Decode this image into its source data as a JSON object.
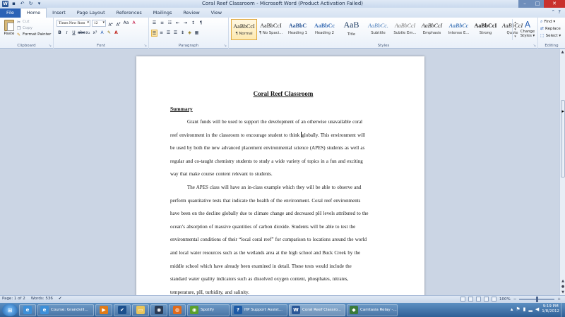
{
  "window": {
    "title": "Coral Reef Classroom - Microsoft Word (Product Activation Failed)",
    "logo": "W"
  },
  "tabs": [
    "File",
    "Home",
    "Insert",
    "Page Layout",
    "References",
    "Mailings",
    "Review",
    "View"
  ],
  "clipboard": {
    "paste": "Paste",
    "cut": "Cut",
    "copy": "Copy",
    "format_painter": "Format Painter",
    "label": "Clipboard"
  },
  "font": {
    "name": "Times New Rom",
    "size": "12",
    "label": "Font"
  },
  "paragraph": {
    "label": "Paragraph"
  },
  "styles": {
    "label": "Styles",
    "items": [
      {
        "sample": "AaBbCcI",
        "name": "¶ Normal"
      },
      {
        "sample": "AaBbCcI",
        "name": "¶ No Spaci..."
      },
      {
        "sample": "AaBbC",
        "name": "Heading 1"
      },
      {
        "sample": "AaBbCc",
        "name": "Heading 2"
      },
      {
        "sample": "AaB",
        "name": "Title"
      },
      {
        "sample": "AaBbCc.",
        "name": "Subtitle"
      },
      {
        "sample": "AaBbCcI",
        "name": "Subtle Em..."
      },
      {
        "sample": "AaBbCcI",
        "name": "Emphasis"
      },
      {
        "sample": "AaBbCc",
        "name": "Intense E..."
      },
      {
        "sample": "AaBbCcI",
        "name": "Strong"
      },
      {
        "sample": "AaBbCcI",
        "name": "Quote"
      }
    ],
    "change_styles_line1": "Change",
    "change_styles_line2": "Styles ▾"
  },
  "editing": {
    "find": "Find ▾",
    "replace": "Replace",
    "select": "Select ▾",
    "label": "Editing"
  },
  "document": {
    "title": "Coral Reef Classroom",
    "heading": "Summary",
    "para1": [
      "Grant funds will be used to support the development of an otherwise unavailable  coral",
      "reef environment in the classroom to encourage student to think",
      "be used by both the new advanced placement environmental science (APES) students as well as",
      "regular and co-taught chemistry students to study a wide variety of topics in a fun and exciting",
      "way that make course content relevant to students."
    ],
    "para1_line2_after_cursor": "globally. This environment will",
    "para2": [
      "The APES class will have an in-class example which they will be able to observe and",
      "perform quantitative tests that indicate the health of the environment. Coral reef environments",
      "have been on the decline globally due to climate change and decreased pH levels attributed to the",
      "ocean’s absorption of massive quantities of carbon dioxide. Students will be able to test the",
      "environmental conditions of their “local coral reef” for comparison to locations around the world",
      "and local water resources such as the wetlands area at the high school and Buck Creek by the",
      "middle school which have already been examined in detail. These tests would include the",
      "standard water quality indicators such as dissolved oxygen content, phosphates, nitrates,",
      "temperature, pH, turbidity, and salinity."
    ]
  },
  "status": {
    "page": "Page: 1 of 2",
    "words": "Words: 536",
    "zoom": "100%"
  },
  "taskbar": {
    "items": [
      {
        "label": "",
        "icon": "ie-icon",
        "glyph": "e",
        "color": "#3d8fd8"
      },
      {
        "label": "Course: Grandvill...",
        "icon": "ie-icon",
        "glyph": "e",
        "color": "#3d8fd8"
      },
      {
        "label": "",
        "icon": "media-player-icon",
        "glyph": "▶",
        "color": "#e07b18"
      },
      {
        "label": "",
        "icon": "checkmark-icon",
        "glyph": "✔",
        "color": "#1c4f8c"
      },
      {
        "label": "",
        "icon": "folder-icon",
        "glyph": "▭",
        "color": "#e8c45a"
      },
      {
        "label": "",
        "icon": "steam-icon",
        "glyph": "◉",
        "color": "#2a3b55"
      },
      {
        "label": "",
        "icon": "firefox-icon",
        "glyph": "◍",
        "color": "#e06a1b"
      },
      {
        "label": "Spotify",
        "icon": "spotify-icon",
        "glyph": "◉",
        "color": "#5aa02c"
      },
      {
        "label": "HP Support Assist...",
        "icon": "help-icon",
        "glyph": "?",
        "color": "#1d5aa6"
      },
      {
        "label": "Coral Reef Classro...",
        "icon": "word-icon",
        "glyph": "W",
        "color": "#2b5797"
      },
      {
        "label": "Camtasia Relay -...",
        "icon": "camtasia-icon",
        "glyph": "◆",
        "color": "#3a7a3a"
      }
    ],
    "time": "9:19 PM",
    "date": "1/8/2012"
  }
}
